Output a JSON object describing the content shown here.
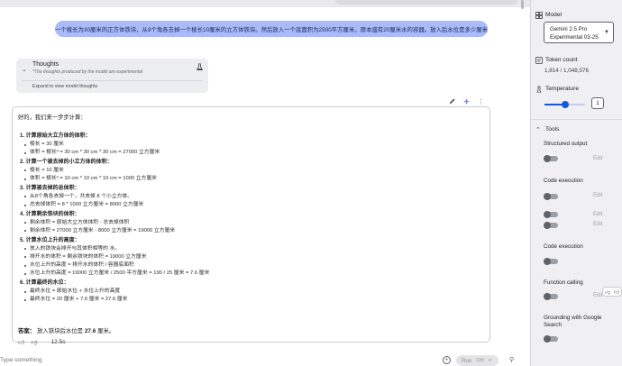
{
  "chat": {
    "user_prompt": "一个棱长为30厘米的正方体铁块，从8个角各去掉一个棱长10厘米的立方体铁块。然后放入一个底面积为2500平方厘米，原本盛有20厘米水的容器。放入后水位是多少厘米",
    "thoughts": {
      "title": "Thoughts",
      "subtitle": "*The thoughts produced by the model are experimental",
      "expand_label": "Expand to view model thoughts"
    },
    "response": {
      "intro": "好的，我们来一步步计算：",
      "sections": [
        {
          "title": "1. 计算原始大立方体的体积：",
          "bullets": [
            "棱长 = 30 厘米",
            "体积 = 棱长³ = 30 cm * 30 cm * 30 cm = 27000 立方厘米"
          ]
        },
        {
          "title": "2. 计算一个被去掉的小立方体的体积：",
          "bullets": [
            "棱长 = 10 厘米",
            "体积 = 棱长³ = 10 cm * 10 cm * 10 cm = 1000 立方厘米"
          ]
        },
        {
          "title": "3. 计算被去掉的总体积：",
          "bullets": [
            "从8个角各去掉一个，共去掉 8 个小立方体。",
            "总去掉体积 = 8 * 1000 立方厘米 = 8000 立方厘米"
          ]
        },
        {
          "title": "4. 计算剩余铁块的体积：",
          "bullets": [
            "剩余体积 = 原始大立方体体积 - 总去掉体积",
            "剩余体积 = 27000 立方厘米 - 8000 立方厘米 = 19000 立方厘米"
          ]
        },
        {
          "title": "5. 计算水位上升的高度：",
          "bullets": [
            "放入的铁块会排开与其体积相等的 水。",
            "排开水的体积 = 剩余铁块的体积 = 19000 立方厘米",
            "水位上升的高度 = 排开水的体积 / 容器底面积",
            "水位上升的高度 = 19000 立方厘米 / 2500 平方厘米 = 190 / 25 厘米 = 7.6 厘米"
          ]
        },
        {
          "title": "6. 计算最终的水位：",
          "bullets": [
            "最终水位 = 原始水位 + 水位上升的高度",
            "最终水位 = 20 厘米 + 7.6 厘米 = 27.6 厘米"
          ]
        }
      ],
      "answer_prefix": "答案：",
      "answer_text": " 放入铁块后水位是 ",
      "answer_value": "27.6",
      "answer_suffix": " 厘米。"
    },
    "response_time": "12.5s"
  },
  "input": {
    "placeholder": "Type something",
    "run_label": "Run",
    "shortcut": "Ctrl"
  },
  "panel": {
    "model_label": "Model",
    "model_name_line1": "Gemini 2.5 Pro",
    "model_name_line2": "Experimental 03-25",
    "token_label": "Token count",
    "token_value": "1,814 / 1,048,576",
    "temperature_label": "Temperature",
    "temperature_value": "1",
    "temperature_fraction": 0.5,
    "tools_label": "Tools",
    "structured_output": "Structured output",
    "code_execution_1": "Code execution",
    "code_execution_2": "Code execution",
    "function_calling": "Function calling",
    "grounding_line1": "Grounding with Google",
    "grounding_line2": "Search",
    "edit_label": "Edit"
  },
  "colors": {
    "user_bubble": "#a9bcf9",
    "accent": "#1a56db",
    "panel_bg": "#f0f0f3"
  }
}
